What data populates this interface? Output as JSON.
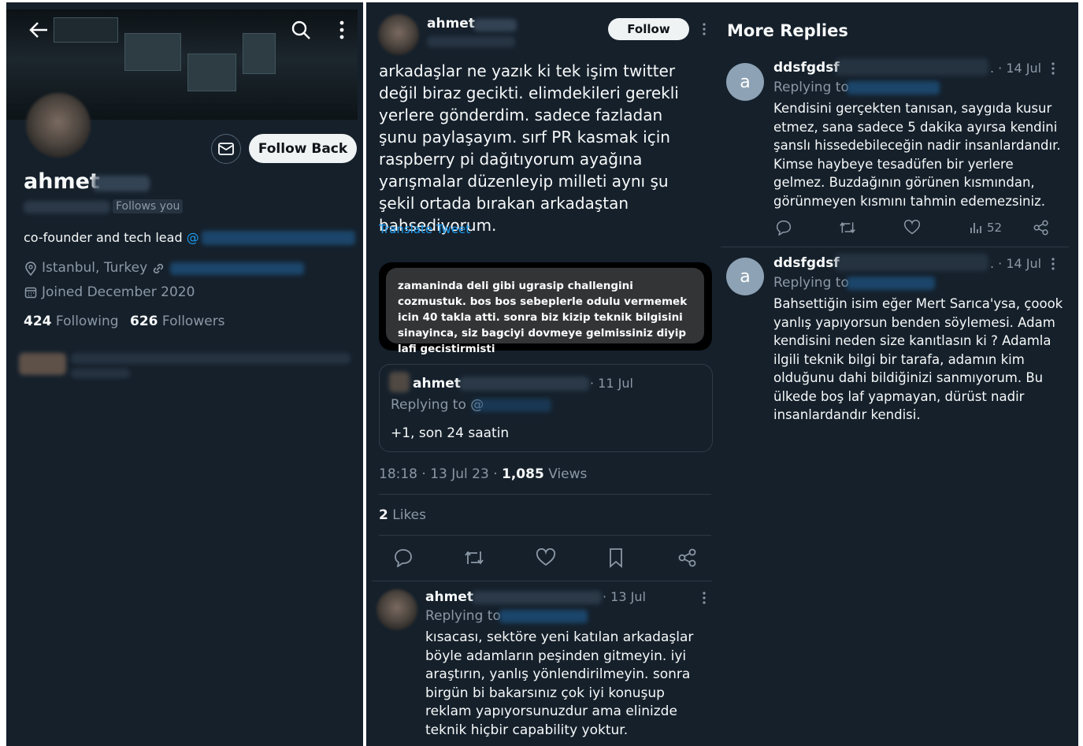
{
  "profile": {
    "name": "ahmet",
    "follows_you": "Follows you",
    "bio": "co-founder and tech lead",
    "bio_mention_prefix": "@",
    "location": "Istanbul, Turkey",
    "joined": "Joined December 2020",
    "following_count": "424",
    "following_label": "Following",
    "followers_count": "626",
    "followers_label": "Followers",
    "follow_back_label": "Follow Back"
  },
  "tweet": {
    "author": "ahmet",
    "follow_label": "Follow",
    "text": "arkadaşlar ne yazık ki tek işim twitter değil biraz gecikti. elimdekileri gerekli yerlere gönderdim. sadece fazladan şunu paylaşayım. sırf PR kasmak için raspberry pi dağıtıyorum ayağına yarışmalar düzenleyip milleti aynı şu şekil ortada bırakan arkadaştan bahsediyorum.",
    "translate": "Translate Tweet",
    "image_text": "zamaninda deli gibi ugrasip challengini cozmustuk. bos bos sebeplerle odulu vermemek icin 40 takla atti. sonra biz kizip teknik bilgisini sinayinca, siz bagciyi dovmeye gelmissiniz diyip lafi gecistirmisti",
    "quote": {
      "author": "ahmet",
      "date": "· 11 Jul",
      "replying": "Replying to @",
      "text": "+1, son 24 saatin"
    },
    "meta_time": "18:18 · 13 Jul 23 ·",
    "views_count": "1,085",
    "views_label": "Views",
    "likes_count": "2",
    "likes_label": "Likes"
  },
  "reply": {
    "author": "ahmet",
    "date": "· 13 Jul",
    "replying": "Replying to",
    "text": "kısacası, sektöre yeni katılan arkadaşlar böyle adamların peşinden gitmeyin. iyi araştırın, yanlış yönlendirilmeyin. sonra birgün bi bakarsınız çok iyi konuşup reklam yapıyorsunuzdur ama elinizde teknik hiçbir capability yoktur."
  },
  "more_replies": {
    "title": "More Replies",
    "items": [
      {
        "avatar_letter": "a",
        "author": "ddsfgdsf",
        "date": ". · 14 Jul",
        "replying": "Replying to",
        "text": "Kendisini gerçekten tanısan, saygıda kusur etmez, sana sadece 5 dakika ayırsa kendini şanslı hissedebileceğin nadir insanlardandır. Kimse haybeye tesadüfen bir yerlere gelmez. Buzdağının görünen kısmından, görünmeyen kısmını tahmin edemezsiniz.",
        "views": "52"
      },
      {
        "avatar_letter": "a",
        "author": "ddsfgdsf",
        "date": ". · 14 Jul",
        "replying": "Replying to",
        "text": "Bahsettiğin isim eğer Mert Sarıca'ysa, çoook yanlış yapıyorsun benden söylemesi. Adam kendisini neden size kanıtlasın ki ? Adamla ilgili teknik bilgi bir tarafa, adamın kim olduğunu dahi bildiğinizi sanmıyorum. Bu ülkede boş laf yapmayan, dürüst nadir insanlardandır kendisi."
      }
    ]
  }
}
